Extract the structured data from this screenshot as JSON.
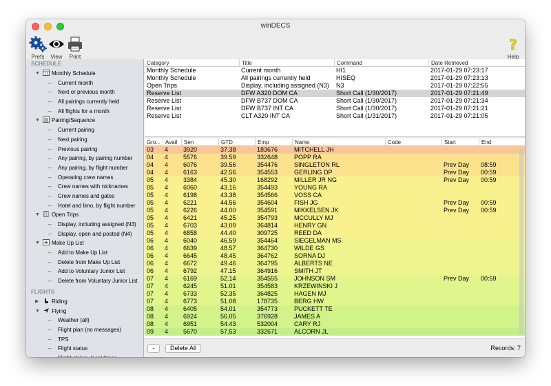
{
  "window": {
    "title": "winDECS"
  },
  "toolbar": {
    "prefs_label": "Prefs",
    "view_label": "View",
    "print_label": "Print",
    "help_label": "Help"
  },
  "sidebar": {
    "sections": [
      {
        "label": "SCHEDULE"
      },
      {
        "label": "FLIGHTS"
      }
    ],
    "items": [
      {
        "type": "parent",
        "label": "Monthly Schedule",
        "icon": "calendar-icon",
        "disc": "▼"
      },
      {
        "type": "child",
        "label": "Current month"
      },
      {
        "type": "child",
        "label": "Next or previous month"
      },
      {
        "type": "child",
        "label": "All pairings currently held"
      },
      {
        "type": "child",
        "label": "All flights for a month"
      },
      {
        "type": "parent",
        "label": "Pairing/Sequence",
        "icon": "list-icon",
        "disc": "▼"
      },
      {
        "type": "child",
        "label": "Current pairing"
      },
      {
        "type": "child",
        "label": "Next pairing"
      },
      {
        "type": "child",
        "label": "Previous pairing"
      },
      {
        "type": "child",
        "label": "Any pairing, by pairing number"
      },
      {
        "type": "child",
        "label": "Any pairing, by flight number"
      },
      {
        "type": "child",
        "label": "Operating crew names"
      },
      {
        "type": "child",
        "label": "Crew names with nicknames"
      },
      {
        "type": "child",
        "label": "Crew names and gates"
      },
      {
        "type": "child",
        "label": "Hotel and limo, by flight number"
      },
      {
        "type": "parent",
        "label": "Open Trips",
        "icon": "trip-icon",
        "disc": "▼"
      },
      {
        "type": "child",
        "label": "Display, including assigned (N3)"
      },
      {
        "type": "child",
        "label": "Display, open and posted (N4)"
      },
      {
        "type": "parent",
        "label": "Make Up List",
        "icon": "plus-box-icon",
        "disc": "▼"
      },
      {
        "type": "child",
        "label": "Add to Make Up List"
      },
      {
        "type": "child",
        "label": "Delete from Make Up List"
      },
      {
        "type": "child",
        "label": "Add to Voluntary Junior List"
      },
      {
        "type": "child",
        "label": "Delete from Voluntary Junior List"
      },
      {
        "type": "section",
        "label": "FLIGHTS"
      },
      {
        "type": "parent",
        "label": "Riding",
        "icon": "seat-icon",
        "disc": "▶"
      },
      {
        "type": "parent",
        "label": "Flying",
        "icon": "plane-icon",
        "disc": "▼"
      },
      {
        "type": "child",
        "label": "Weather (all)"
      },
      {
        "type": "child",
        "label": "Flight plan (no messages)"
      },
      {
        "type": "child",
        "label": "TPS"
      },
      {
        "type": "child",
        "label": "Flight status"
      },
      {
        "type": "child",
        "label": "Flight status, local times"
      }
    ]
  },
  "top_table": {
    "headers": [
      "Category",
      "Title",
      "Command",
      "Date Retrieved"
    ],
    "rows": [
      [
        "Monthly Schedule",
        "Current month",
        "HI1",
        "2017-01-29 07:23:17",
        false
      ],
      [
        "Monthly Schedule",
        "All pairings currently held",
        "HISEQ",
        "2017-01-29 07:23:13",
        false
      ],
      [
        "Open Trips",
        "Display, including assigned (N3)",
        "N3",
        "2017-01-29 07:22:55",
        false
      ],
      [
        "Reserve List",
        "DFW A320 DOM CA",
        "Short Call (1/30/2017)",
        "2017-01-29 07:21:49",
        true
      ],
      [
        "Reserve List",
        "DFW B737 DOM CA",
        "Short Call (1/30/2017)",
        "2017-01-29 07:21:34",
        false
      ],
      [
        "Reserve List",
        "DFW B737 INT CA",
        "Short Call (1/30/2017)",
        "2017-01-29 07:21:21",
        false
      ],
      [
        "Reserve List",
        "CLT A320 INT CA",
        "Short Call (1/31/2017)",
        "2017-01-29 07:21:05",
        false
      ]
    ]
  },
  "bottom_table": {
    "headers": [
      "Gro...",
      "Avail",
      "Sen",
      "GTD",
      "Emp",
      "Name",
      "Code",
      "Start",
      "End"
    ],
    "rows": [
      [
        "03",
        "4",
        "3920",
        "37.38",
        "183676",
        "MITCHELL JH",
        "",
        "",
        "",
        "#f7c79a"
      ],
      [
        "04",
        "4",
        "5576",
        "39.59",
        "332648",
        "POPP RA",
        "",
        "",
        "",
        "#fde28e"
      ],
      [
        "04",
        "4",
        "6076",
        "39.56",
        "354476",
        "SINGLETON RL",
        "",
        "Prev Day",
        "08:59",
        "#fde28e"
      ],
      [
        "04",
        "4",
        "6163",
        "42.56",
        "354553",
        "GERLING DP",
        "",
        "Prev Day",
        "00:59",
        "#fde28e"
      ],
      [
        "05",
        "4",
        "3384",
        "45.30",
        "168292",
        "MILLER JR NG",
        "",
        "Prev Day",
        "00:59",
        "#f9f08e"
      ],
      [
        "05",
        "4",
        "6060",
        "43.16",
        "354493",
        "YOUNG RA",
        "",
        "",
        "",
        "#f9f08e"
      ],
      [
        "05",
        "4",
        "6198",
        "43.38",
        "354566",
        "VOSS CA",
        "",
        "",
        "",
        "#f9f08e"
      ],
      [
        "05",
        "4",
        "6221",
        "44.56",
        "354604",
        "FISH JG",
        "",
        "Prev Day",
        "00:59",
        "#f9f08e"
      ],
      [
        "05",
        "4",
        "6226",
        "44.00",
        "354591",
        "MIKKELSEN JK",
        "",
        "Prev Day",
        "00:59",
        "#f9f08e"
      ],
      [
        "05",
        "4",
        "6421",
        "45.25",
        "354793",
        "MCCULLY MJ",
        "",
        "",
        "",
        "#f9f08e"
      ],
      [
        "05",
        "4",
        "6703",
        "43.09",
        "364814",
        "HENRY GN",
        "",
        "",
        "",
        "#f9f08e"
      ],
      [
        "05",
        "4",
        "6858",
        "44.40",
        "309725",
        "REED DA",
        "",
        "",
        "",
        "#f9f08e"
      ],
      [
        "06",
        "4",
        "6040",
        "46.59",
        "354464",
        "SIEGELMAN MS",
        "",
        "",
        "",
        "#eef58e"
      ],
      [
        "06",
        "4",
        "6639",
        "48.57",
        "364730",
        "WILDE GS",
        "",
        "",
        "",
        "#eef58e"
      ],
      [
        "06",
        "4",
        "6645",
        "48.45",
        "364762",
        "SORNA DJ",
        "",
        "",
        "",
        "#eef58e"
      ],
      [
        "06",
        "4",
        "6672",
        "49.46",
        "364795",
        "ALBERTS NE",
        "",
        "",
        "",
        "#eef58e"
      ],
      [
        "06",
        "4",
        "6792",
        "47.15",
        "364916",
        "SMITH JT",
        "",
        "",
        "",
        "#eef58e"
      ],
      [
        "07",
        "4",
        "6169",
        "52.14",
        "354555",
        "JOHNSON SM",
        "",
        "Prev Day",
        "00:59",
        "#e1f58c"
      ],
      [
        "07",
        "4",
        "6245",
        "51.01",
        "354583",
        "KRZEWINSKI J",
        "",
        "",
        "",
        "#e1f58c"
      ],
      [
        "07",
        "4",
        "6733",
        "52.35",
        "364825",
        "HAGEN MJ",
        "",
        "",
        "",
        "#e1f58c"
      ],
      [
        "07",
        "4",
        "6773",
        "51.08",
        "178735",
        "BERG HW",
        "",
        "",
        "",
        "#e1f58c"
      ],
      [
        "08",
        "4",
        "6405",
        "54.01",
        "354773",
        "PUCKETT TE",
        "",
        "",
        "",
        "#d2f28a"
      ],
      [
        "08",
        "4",
        "6924",
        "56.05",
        "376928",
        "JAMES A",
        "",
        "",
        "",
        "#d2f28a"
      ],
      [
        "08",
        "4",
        "6951",
        "54.43",
        "532004",
        "CARY RJ",
        "",
        "",
        "",
        "#d2f28a"
      ],
      [
        "09",
        "4",
        "5670",
        "57.53",
        "332671",
        "ALCORN JL",
        "",
        "",
        "",
        "#c4ef88"
      ]
    ]
  },
  "footer": {
    "minus_label": "-",
    "delete_all_label": "Delete All",
    "records_text": "Records: 7"
  }
}
